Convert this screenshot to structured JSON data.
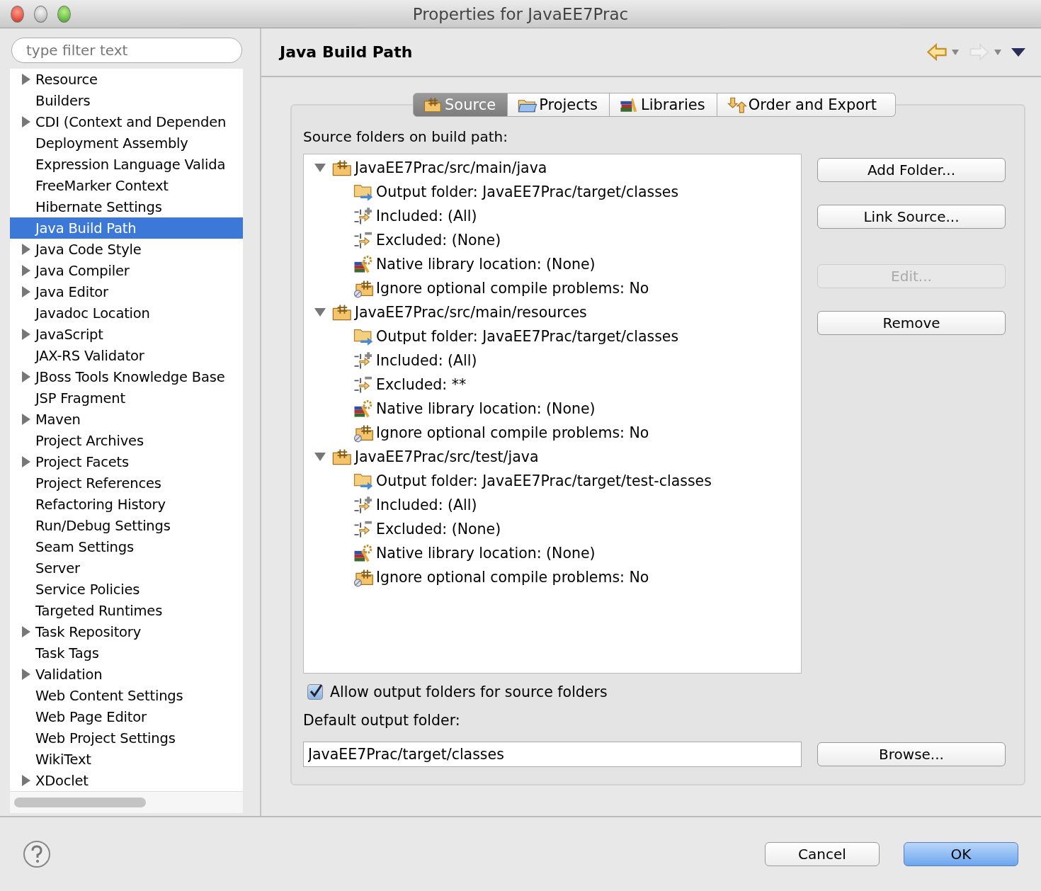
{
  "window": {
    "title": "Properties for JavaEE7Prac"
  },
  "sidebar": {
    "filter": {
      "placeholder": "type filter text"
    },
    "items": [
      {
        "label": "Resource",
        "expandable": true,
        "selected": false
      },
      {
        "label": "Builders",
        "expandable": false,
        "selected": false
      },
      {
        "label": "CDI (Context and Dependen",
        "expandable": true,
        "selected": false
      },
      {
        "label": "Deployment Assembly",
        "expandable": false,
        "selected": false
      },
      {
        "label": "Expression Language Valida",
        "expandable": false,
        "selected": false
      },
      {
        "label": "FreeMarker Context",
        "expandable": false,
        "selected": false
      },
      {
        "label": "Hibernate Settings",
        "expandable": false,
        "selected": false
      },
      {
        "label": "Java Build Path",
        "expandable": false,
        "selected": true
      },
      {
        "label": "Java Code Style",
        "expandable": true,
        "selected": false
      },
      {
        "label": "Java Compiler",
        "expandable": true,
        "selected": false
      },
      {
        "label": "Java Editor",
        "expandable": true,
        "selected": false
      },
      {
        "label": "Javadoc Location",
        "expandable": false,
        "selected": false
      },
      {
        "label": "JavaScript",
        "expandable": true,
        "selected": false
      },
      {
        "label": "JAX-RS Validator",
        "expandable": false,
        "selected": false
      },
      {
        "label": "JBoss Tools Knowledge Base",
        "expandable": true,
        "selected": false
      },
      {
        "label": "JSP Fragment",
        "expandable": false,
        "selected": false
      },
      {
        "label": "Maven",
        "expandable": true,
        "selected": false
      },
      {
        "label": "Project Archives",
        "expandable": false,
        "selected": false
      },
      {
        "label": "Project Facets",
        "expandable": true,
        "selected": false
      },
      {
        "label": "Project References",
        "expandable": false,
        "selected": false
      },
      {
        "label": "Refactoring History",
        "expandable": false,
        "selected": false
      },
      {
        "label": "Run/Debug Settings",
        "expandable": false,
        "selected": false
      },
      {
        "label": "Seam Settings",
        "expandable": false,
        "selected": false
      },
      {
        "label": "Server",
        "expandable": false,
        "selected": false
      },
      {
        "label": "Service Policies",
        "expandable": false,
        "selected": false
      },
      {
        "label": "Targeted Runtimes",
        "expandable": false,
        "selected": false
      },
      {
        "label": "Task Repository",
        "expandable": true,
        "selected": false
      },
      {
        "label": "Task Tags",
        "expandable": false,
        "selected": false
      },
      {
        "label": "Validation",
        "expandable": true,
        "selected": false
      },
      {
        "label": "Web Content Settings",
        "expandable": false,
        "selected": false
      },
      {
        "label": "Web Page Editor",
        "expandable": false,
        "selected": false
      },
      {
        "label": "Web Project Settings",
        "expandable": false,
        "selected": false
      },
      {
        "label": "WikiText",
        "expandable": false,
        "selected": false
      },
      {
        "label": "XDoclet",
        "expandable": true,
        "selected": false
      }
    ]
  },
  "page": {
    "title": "Java Build Path",
    "nav": [
      {
        "kind": "back",
        "disabled": false
      },
      {
        "kind": "forward",
        "disabled": true
      }
    ],
    "tabs": [
      {
        "label": "Source",
        "kind": "source",
        "selected": true
      },
      {
        "label": "Projects",
        "kind": "projects",
        "selected": false
      },
      {
        "label": "Libraries",
        "kind": "libraries",
        "selected": false
      },
      {
        "label": "Order and Export",
        "kind": "order",
        "selected": false
      }
    ],
    "source_label": "Source folders on build path:",
    "source_tree": [
      {
        "label": "JavaEE7Prac/src/main/java",
        "expanded": true,
        "children": [
          {
            "kind": "output",
            "label": "Output folder: JavaEE7Prac/target/classes"
          },
          {
            "kind": "included",
            "label": "Included: (All)"
          },
          {
            "kind": "excluded",
            "label": "Excluded: (None)"
          },
          {
            "kind": "native",
            "label": "Native library location: (None)"
          },
          {
            "kind": "ignore",
            "label": "Ignore optional compile problems: No"
          }
        ]
      },
      {
        "label": "JavaEE7Prac/src/main/resources",
        "expanded": true,
        "children": [
          {
            "kind": "output",
            "label": "Output folder: JavaEE7Prac/target/classes"
          },
          {
            "kind": "included",
            "label": "Included: (All)"
          },
          {
            "kind": "excluded",
            "label": "Excluded: **"
          },
          {
            "kind": "native",
            "label": "Native library location: (None)"
          },
          {
            "kind": "ignore",
            "label": "Ignore optional compile problems: No"
          }
        ]
      },
      {
        "label": "JavaEE7Prac/src/test/java",
        "expanded": true,
        "children": [
          {
            "kind": "output",
            "label": "Output folder: JavaEE7Prac/target/test-classes"
          },
          {
            "kind": "included",
            "label": "Included: (All)"
          },
          {
            "kind": "excluded",
            "label": "Excluded: (None)"
          },
          {
            "kind": "native",
            "label": "Native library location: (None)"
          },
          {
            "kind": "ignore",
            "label": "Ignore optional compile problems: No"
          }
        ]
      }
    ],
    "side_buttons": [
      {
        "label": "Add Folder...",
        "disabled": false
      },
      {
        "label": "Link Source...",
        "disabled": false
      },
      {
        "label": "Edit...",
        "disabled": true
      },
      {
        "label": "Remove",
        "disabled": false
      }
    ],
    "allow_output": {
      "label": "Allow output folders for source folders",
      "checked": true
    },
    "default_output": {
      "label": "Default output folder:",
      "value": "JavaEE7Prac/target/classes",
      "button": "Browse..."
    }
  },
  "buttons": [
    {
      "label": "Cancel",
      "default": false
    },
    {
      "label": "OK",
      "default": true
    }
  ]
}
